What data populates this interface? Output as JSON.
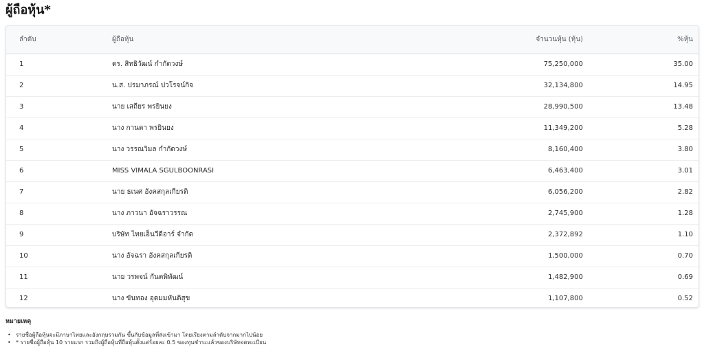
{
  "page_title": "ผู้ถือหุ้น*",
  "table": {
    "headers": {
      "rank": "ลำดับ",
      "name": "ผู้ถือหุ้น",
      "shares": "จำนวนหุ้น (หุ้น)",
      "percent": "%หุ้น"
    },
    "rows": [
      {
        "rank": "1",
        "name": "ดร. สิทธิวัฒน์ กำกัดวงษ์",
        "shares": "75,250,000",
        "percent": "35.00"
      },
      {
        "rank": "2",
        "name": "น.ส. ปรมาภรณ์ ปวโรจน์กิจ",
        "shares": "32,134,800",
        "percent": "14.95"
      },
      {
        "rank": "3",
        "name": "นาย เสถียร พรยินยง",
        "shares": "28,990,500",
        "percent": "13.48"
      },
      {
        "rank": "4",
        "name": "นาง กานดา พรยินยง",
        "shares": "11,349,200",
        "percent": "5.28"
      },
      {
        "rank": "5",
        "name": "นาง วรรณวิมล กำกัดวงษ์",
        "shares": "8,160,400",
        "percent": "3.80"
      },
      {
        "rank": "6",
        "name": "MISS VIMALA SGULBOONRASI",
        "shares": "6,463,400",
        "percent": "3.01"
      },
      {
        "rank": "7",
        "name": "นาย ธเนศ อังคสกุลเกียรติ",
        "shares": "6,056,200",
        "percent": "2.82"
      },
      {
        "rank": "8",
        "name": "นาง ภาวนา อัจฉราวรรณ",
        "shares": "2,745,900",
        "percent": "1.28"
      },
      {
        "rank": "9",
        "name": "บริษัท ไทยเอ็นวีดีอาร์ จำกัด",
        "shares": "2,372,892",
        "percent": "1.10"
      },
      {
        "rank": "10",
        "name": "นาง อัจฉรา อังคสกุลเกียรติ",
        "shares": "1,500,000",
        "percent": "0.70"
      },
      {
        "rank": "11",
        "name": "นาย วรพจน์ กันตพิพัฒน์",
        "shares": "1,482,900",
        "percent": "0.69"
      },
      {
        "rank": "12",
        "name": "นาง ขันทอง อุดมมหันติสุข",
        "shares": "1,107,800",
        "percent": "0.52"
      }
    ]
  },
  "notes": {
    "title": "หมายเหตุ",
    "bullet": "•",
    "items": [
      "รายชื่อผู้ถือหุ้นจะมีภาษาไทยและอังกฤษรวมกัน ขึ้นกับข้อมูลที่ส่งเข้ามา โดยเรียงตามลำดับจากมากไปน้อย",
      "* รายชื่อผู้ถือหุ้น 10 รายแรก รวมถึงผู้ถือหุ้นที่ถือหุ้นตั้งแต่ร้อยละ 0.5 ของทุนชำระแล้วของบริษัทจดทะเบียน"
    ]
  }
}
